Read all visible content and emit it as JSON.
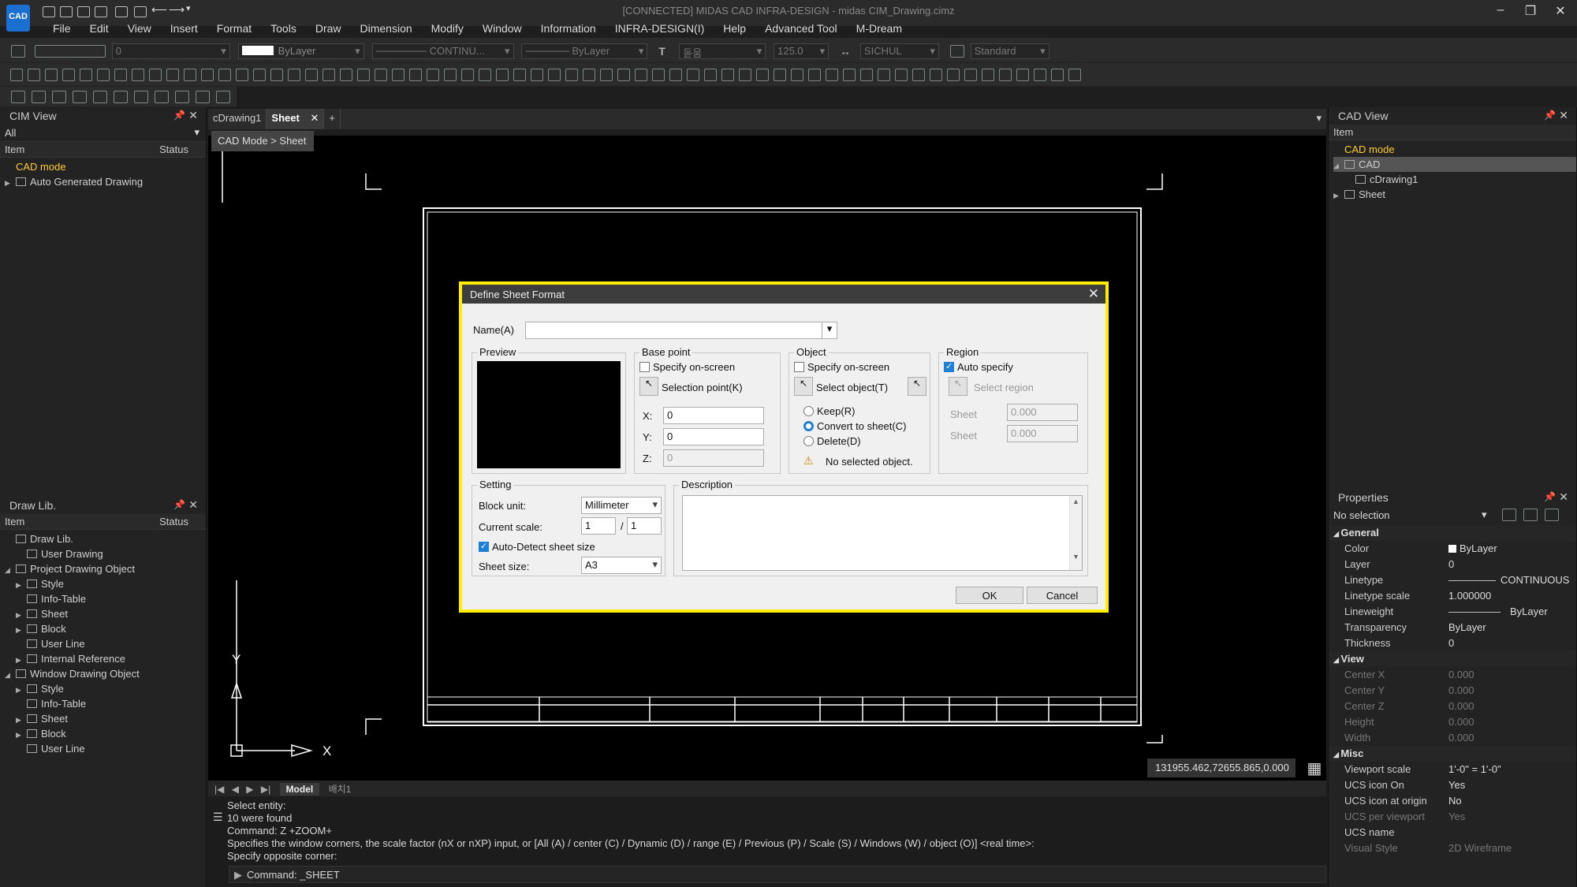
{
  "app": {
    "logo": "CAD",
    "title": "[CONNECTED] MIDAS CAD INFRA-DESIGN - midas CIM_Drawing.cimz"
  },
  "menu": [
    "File",
    "Edit",
    "View",
    "Insert",
    "Format",
    "Tools",
    "Draw",
    "Dimension",
    "Modify",
    "Window",
    "Information",
    "INFRA-DESIGN(I)",
    "Help",
    "Advanced Tool",
    "M-Dream"
  ],
  "toolbar": {
    "layer": "0",
    "color": "ByLayer",
    "linetype": "CONTINU...",
    "lineweight": "ByLayer",
    "textstyle": "돋움",
    "textheight": "125.0",
    "dimstyle": "SICHUL",
    "tablestyle": "Standard"
  },
  "cim_view": {
    "title": "CIM View",
    "filter": "All",
    "col_item": "Item",
    "col_status": "Status",
    "items": [
      {
        "label": "CAD mode",
        "accent": true,
        "toggle": "",
        "indent": 0
      },
      {
        "label": "Auto Generated Drawing",
        "accent": false,
        "toggle": "▶",
        "indent": 0
      }
    ]
  },
  "draw_lib": {
    "title": "Draw Lib.",
    "col_item": "Item",
    "col_status": "Status",
    "items": [
      {
        "label": "Draw Lib.",
        "toggle": "",
        "indent": 0
      },
      {
        "label": "User Drawing",
        "toggle": "",
        "indent": 1
      },
      {
        "label": "Project Drawing Object",
        "toggle": "◢",
        "indent": 0
      },
      {
        "label": "Style",
        "toggle": "▶",
        "indent": 1
      },
      {
        "label": "Info-Table",
        "toggle": "",
        "indent": 1
      },
      {
        "label": "Sheet",
        "toggle": "▶",
        "indent": 1
      },
      {
        "label": "Block",
        "toggle": "▶",
        "indent": 1
      },
      {
        "label": "User Line",
        "toggle": "",
        "indent": 1
      },
      {
        "label": "Internal Reference",
        "toggle": "▶",
        "indent": 1
      },
      {
        "label": "Window Drawing Object",
        "toggle": "◢",
        "indent": 0
      },
      {
        "label": "Style",
        "toggle": "▶",
        "indent": 1
      },
      {
        "label": "Info-Table",
        "toggle": "",
        "indent": 1
      },
      {
        "label": "Sheet",
        "toggle": "▶",
        "indent": 1
      },
      {
        "label": "Block",
        "toggle": "▶",
        "indent": 1
      },
      {
        "label": "User Line",
        "toggle": "",
        "indent": 1
      }
    ]
  },
  "doc_tabs": [
    "cDrawing1",
    "Sheet"
  ],
  "viewport_label": "CAD Mode > Sheet",
  "axis": {
    "x": "X",
    "y": "Y"
  },
  "dialog": {
    "title": "Define Sheet Format",
    "name_label": "Name(A)",
    "name_value": "",
    "preview_label": "Preview",
    "base_point": {
      "label": "Base point",
      "specify": "Specify on-screen",
      "select_btn": "Selection point(K)",
      "x_label": "X:",
      "x": "0",
      "y_label": "Y:",
      "y": "0",
      "z_label": "Z:",
      "z": "0"
    },
    "object": {
      "label": "Object",
      "specify": "Specify on-screen",
      "select_btn": "Select object(T)",
      "keep": "Keep(R)",
      "convert": "Convert to sheet(C)",
      "delete": "Delete(D)",
      "warning": "No selected object."
    },
    "region": {
      "label": "Region",
      "auto": "Auto specify",
      "select_btn": "Select region",
      "sheet1_label": "Sheet",
      "sheet1": "0.000",
      "sheet2_label": "Sheet",
      "sheet2": "0.000"
    },
    "setting": {
      "label": "Setting",
      "block_unit_label": "Block unit:",
      "block_unit": "Millimeter",
      "scale_label": "Current scale:",
      "scale_a": "1",
      "scale_sep": "/",
      "scale_b": "1",
      "auto_detect": "Auto-Detect sheet size",
      "sheet_size_label": "Sheet size:",
      "sheet_size": "A3"
    },
    "description_label": "Description",
    "ok": "OK",
    "cancel": "Cancel"
  },
  "layouts": {
    "model": "Model",
    "layout1": "배치1"
  },
  "command": {
    "lines": [
      "Select entity:",
      "10 were found",
      "Command:  Z +ZOOM+",
      "Specifies the window corners, the scale factor (nX or nXP) input, or [All (A) / center (C) / Dynamic (D) / range (E) / Previous (P) / Scale (S) / Windows (W) / object (O)] <real time>:",
      "Specify opposite corner:"
    ],
    "prompt": "Command:  _SHEET"
  },
  "coordinates": "131955.462,72655.865,0.000",
  "cad_view": {
    "title": "CAD View",
    "col_item": "Item",
    "items": [
      {
        "label": "CAD mode",
        "accent": true,
        "toggle": "",
        "indent": 0
      },
      {
        "label": "CAD",
        "accent": false,
        "toggle": "◢",
        "indent": 0,
        "selected": true
      },
      {
        "label": "cDrawing1",
        "accent": false,
        "toggle": "",
        "indent": 1
      },
      {
        "label": "Sheet",
        "accent": false,
        "toggle": "▶",
        "indent": 0
      }
    ]
  },
  "properties": {
    "title": "Properties",
    "selection": "No selection",
    "general_label": "General",
    "general": [
      {
        "k": "Color",
        "v": "ByLayer"
      },
      {
        "k": "Layer",
        "v": "0"
      },
      {
        "k": "Linetype",
        "v": "CONTINUOUS"
      },
      {
        "k": "Linetype scale",
        "v": "1.000000"
      },
      {
        "k": "Lineweight",
        "v": "ByLayer"
      },
      {
        "k": "Transparency",
        "v": "ByLayer"
      },
      {
        "k": "Thickness",
        "v": "0"
      }
    ],
    "view_label": "View",
    "view": [
      {
        "k": "Center X",
        "v": "0.000"
      },
      {
        "k": "Center Y",
        "v": "0.000"
      },
      {
        "k": "Center Z",
        "v": "0.000"
      },
      {
        "k": "Height",
        "v": "0.000"
      },
      {
        "k": "Width",
        "v": "0.000"
      }
    ],
    "misc_label": "Misc",
    "misc": [
      {
        "k": "Viewport scale",
        "v": "1'-0\" = 1'-0\"",
        "dim": false
      },
      {
        "k": "UCS icon On",
        "v": "Yes",
        "dim": false
      },
      {
        "k": "UCS icon at origin",
        "v": "No",
        "dim": false
      },
      {
        "k": "UCS per viewport",
        "v": "Yes",
        "dim": true
      },
      {
        "k": "UCS name",
        "v": "",
        "dim": false
      },
      {
        "k": "Visual Style",
        "v": "2D Wireframe",
        "dim": true
      }
    ]
  },
  "colors": {
    "accent": "#ffcc33",
    "highlight": "#ffee00",
    "canvas": "#000000"
  }
}
